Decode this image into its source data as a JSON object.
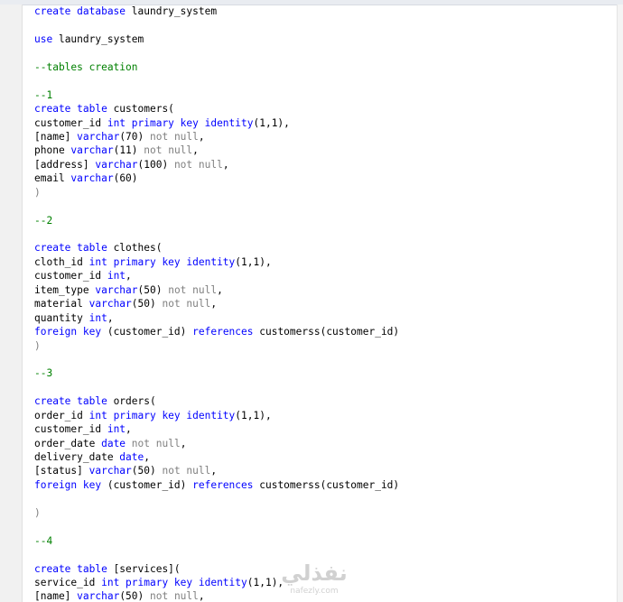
{
  "code": {
    "lines": [
      [
        {
          "t": "create database",
          "c": "kw"
        },
        {
          "t": " laundry_system",
          "c": "tx"
        }
      ],
      [],
      [
        {
          "t": "use",
          "c": "kw"
        },
        {
          "t": " laundry_system",
          "c": "tx"
        }
      ],
      [],
      [
        {
          "t": "--tables creation",
          "c": "cm"
        }
      ],
      [],
      [
        {
          "t": "--1",
          "c": "cm"
        }
      ],
      [
        {
          "t": "create table",
          "c": "kw"
        },
        {
          "t": " customers(",
          "c": "tx"
        }
      ],
      [
        {
          "t": "customer_id ",
          "c": "tx"
        },
        {
          "t": "int primary key identity",
          "c": "kw"
        },
        {
          "t": "(1,1),",
          "c": "tx"
        }
      ],
      [
        {
          "t": "[name] ",
          "c": "tx"
        },
        {
          "t": "varchar",
          "c": "kw"
        },
        {
          "t": "(70) ",
          "c": "tx"
        },
        {
          "t": "not null",
          "c": "gr"
        },
        {
          "t": ",",
          "c": "tx"
        }
      ],
      [
        {
          "t": "phone ",
          "c": "tx"
        },
        {
          "t": "varchar",
          "c": "kw"
        },
        {
          "t": "(11) ",
          "c": "tx"
        },
        {
          "t": "not null",
          "c": "gr"
        },
        {
          "t": ",",
          "c": "tx"
        }
      ],
      [
        {
          "t": "[address] ",
          "c": "tx"
        },
        {
          "t": "varchar",
          "c": "kw"
        },
        {
          "t": "(100) ",
          "c": "tx"
        },
        {
          "t": "not null",
          "c": "gr"
        },
        {
          "t": ",",
          "c": "tx"
        }
      ],
      [
        {
          "t": "email ",
          "c": "tx"
        },
        {
          "t": "varchar",
          "c": "kw"
        },
        {
          "t": "(60)",
          "c": "tx"
        }
      ],
      [
        {
          "t": ")",
          "c": "gr"
        }
      ],
      [],
      [
        {
          "t": "--2",
          "c": "cm"
        }
      ],
      [],
      [
        {
          "t": "create table",
          "c": "kw"
        },
        {
          "t": " clothes(",
          "c": "tx"
        }
      ],
      [
        {
          "t": "cloth_id ",
          "c": "tx"
        },
        {
          "t": "int primary key identity",
          "c": "kw"
        },
        {
          "t": "(1,1),",
          "c": "tx"
        }
      ],
      [
        {
          "t": "customer_id ",
          "c": "tx"
        },
        {
          "t": "int",
          "c": "kw"
        },
        {
          "t": ",",
          "c": "tx"
        }
      ],
      [
        {
          "t": "item_type ",
          "c": "tx"
        },
        {
          "t": "varchar",
          "c": "kw"
        },
        {
          "t": "(50) ",
          "c": "tx"
        },
        {
          "t": "not null",
          "c": "gr"
        },
        {
          "t": ",",
          "c": "tx"
        }
      ],
      [
        {
          "t": "material ",
          "c": "tx"
        },
        {
          "t": "varchar",
          "c": "kw"
        },
        {
          "t": "(50) ",
          "c": "tx"
        },
        {
          "t": "not null",
          "c": "gr"
        },
        {
          "t": ",",
          "c": "tx"
        }
      ],
      [
        {
          "t": "quantity ",
          "c": "tx"
        },
        {
          "t": "int",
          "c": "kw"
        },
        {
          "t": ",",
          "c": "tx"
        }
      ],
      [
        {
          "t": "foreign key",
          "c": "kw"
        },
        {
          "t": " (customer_id) ",
          "c": "tx"
        },
        {
          "t": "references",
          "c": "kw"
        },
        {
          "t": " customerss(customer_id)",
          "c": "tx"
        }
      ],
      [
        {
          "t": ")",
          "c": "gr"
        }
      ],
      [],
      [
        {
          "t": "--3",
          "c": "cm"
        }
      ],
      [],
      [
        {
          "t": "create table",
          "c": "kw"
        },
        {
          "t": " orders(",
          "c": "tx"
        }
      ],
      [
        {
          "t": "order_id ",
          "c": "tx"
        },
        {
          "t": "int primary key identity",
          "c": "kw"
        },
        {
          "t": "(1,1),",
          "c": "tx"
        }
      ],
      [
        {
          "t": "customer_id ",
          "c": "tx"
        },
        {
          "t": "int",
          "c": "kw"
        },
        {
          "t": ",",
          "c": "tx"
        }
      ],
      [
        {
          "t": "order_date ",
          "c": "tx"
        },
        {
          "t": "date",
          "c": "kw"
        },
        {
          "t": " ",
          "c": "tx"
        },
        {
          "t": "not null",
          "c": "gr"
        },
        {
          "t": ",",
          "c": "tx"
        }
      ],
      [
        {
          "t": "delivery_date ",
          "c": "tx"
        },
        {
          "t": "date",
          "c": "kw"
        },
        {
          "t": ",",
          "c": "tx"
        }
      ],
      [
        {
          "t": "[status] ",
          "c": "tx"
        },
        {
          "t": "varchar",
          "c": "kw"
        },
        {
          "t": "(50) ",
          "c": "tx"
        },
        {
          "t": "not null",
          "c": "gr"
        },
        {
          "t": ",",
          "c": "tx"
        }
      ],
      [
        {
          "t": "foreign key",
          "c": "kw"
        },
        {
          "t": " (customer_id) ",
          "c": "tx"
        },
        {
          "t": "references",
          "c": "kw"
        },
        {
          "t": " customerss(customer_id)",
          "c": "tx"
        }
      ],
      [],
      [
        {
          "t": ")",
          "c": "gr"
        }
      ],
      [],
      [
        {
          "t": "--4",
          "c": "cm"
        }
      ],
      [],
      [
        {
          "t": "create table",
          "c": "kw"
        },
        {
          "t": " [services](",
          "c": "tx"
        }
      ],
      [
        {
          "t": "service_id ",
          "c": "tx"
        },
        {
          "t": "int primary key identity",
          "c": "kw"
        },
        {
          "t": "(1,1),",
          "c": "tx"
        }
      ],
      [
        {
          "t": "[name] ",
          "c": "tx"
        },
        {
          "t": "varchar",
          "c": "kw"
        },
        {
          "t": "(50) ",
          "c": "tx"
        },
        {
          "t": "not null",
          "c": "gr"
        },
        {
          "t": ",",
          "c": "tx"
        }
      ]
    ]
  },
  "watermark": {
    "arabic": "نفذلي",
    "latin": "nafezly.com"
  },
  "colors": {
    "keyword": "#0000ff",
    "comment": "#008000",
    "operator": "#808080",
    "text": "#000000",
    "background": "#ffffff"
  }
}
